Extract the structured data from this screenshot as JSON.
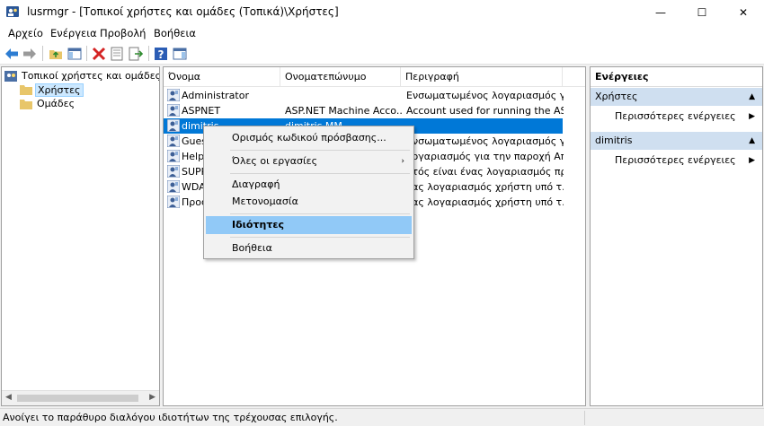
{
  "window": {
    "title": "lusrmgr - [Τοπικοί χρήστες και ομάδες (Τοπικά)\\Χρήστες]",
    "controls": {
      "minimize": "—",
      "maximize": "☐",
      "close": "✕"
    }
  },
  "menu": [
    "Αρχείο",
    "Ενέργεια",
    "Προβολή",
    "Βοήθεια"
  ],
  "toolbar": {
    "icons": [
      "back-arrow-icon",
      "forward-arrow-icon",
      "up-folder-icon",
      "show-hide-tree-icon",
      "delete-icon",
      "properties-icon",
      "export-list-icon",
      "help-icon",
      "show-hide-action-pane-icon"
    ]
  },
  "tree": {
    "root": "Τοπικοί χρήστες και ομάδες (Το",
    "children": [
      {
        "label": "Χρήστες",
        "selected": true
      },
      {
        "label": "Ομάδες",
        "selected": false
      }
    ]
  },
  "list": {
    "columns": [
      "Όνομα",
      "Ονοματεπώνυμο",
      "Περιγραφή"
    ],
    "rows": [
      {
        "name": "Administrator",
        "fullname": "",
        "description": "Ενσωματωμένος λογαριασμός γι..."
      },
      {
        "name": "ASPNET",
        "fullname": "ASP.NET Machine Acco...",
        "description": "Account used for running the AS..."
      },
      {
        "name": "dimitris",
        "fullname": "dimitris MM",
        "description": "",
        "selected": true
      },
      {
        "name": "Guest",
        "fullname": "",
        "description": "Ενσωματωμένος λογαριασμός γι..."
      },
      {
        "name": "Help",
        "fullname": "",
        "description": "λογαριασμός για την παροχή Απ..."
      },
      {
        "name": "SUPP",
        "fullname": "",
        "description": "υτός είναι ένας λογαριασμός πρ..."
      },
      {
        "name": "WDA",
        "fullname": "",
        "description": "νας λογαριασμός χρήστη υπό τ..."
      },
      {
        "name": "Προσ",
        "fullname": "",
        "description": "νας λογαριασμός χρήστη υπό τ..."
      }
    ]
  },
  "context_menu": {
    "items": [
      {
        "label": "Ορισμός κωδικού πρόσβασης...",
        "submenu": false,
        "highlighted": false
      },
      {
        "label": "Όλες οι εργασίες",
        "submenu": true,
        "highlighted": false
      },
      {
        "label": "Διαγραφή",
        "submenu": false,
        "highlighted": false
      },
      {
        "label": "Μετονομασία",
        "submenu": false,
        "highlighted": false
      },
      {
        "label": "Ιδιότητες",
        "submenu": false,
        "highlighted": true
      },
      {
        "label": "Βοήθεια",
        "submenu": false,
        "highlighted": false
      }
    ]
  },
  "actions": {
    "title": "Ενέργειες",
    "sections": [
      {
        "header": "Χρήστες",
        "item": "Περισσότερες ενέργειες"
      },
      {
        "header": "dimitris",
        "item": "Περισσότερες ενέργειες"
      }
    ]
  },
  "status": {
    "text": "Ανοίγει το παράθυρο διαλόγου ιδιοτήτων της τρέχουσας επιλογής."
  },
  "colors": {
    "selection": "#0078d7",
    "menu_highlight": "#91c9f7",
    "action_header": "#cfdff0"
  }
}
